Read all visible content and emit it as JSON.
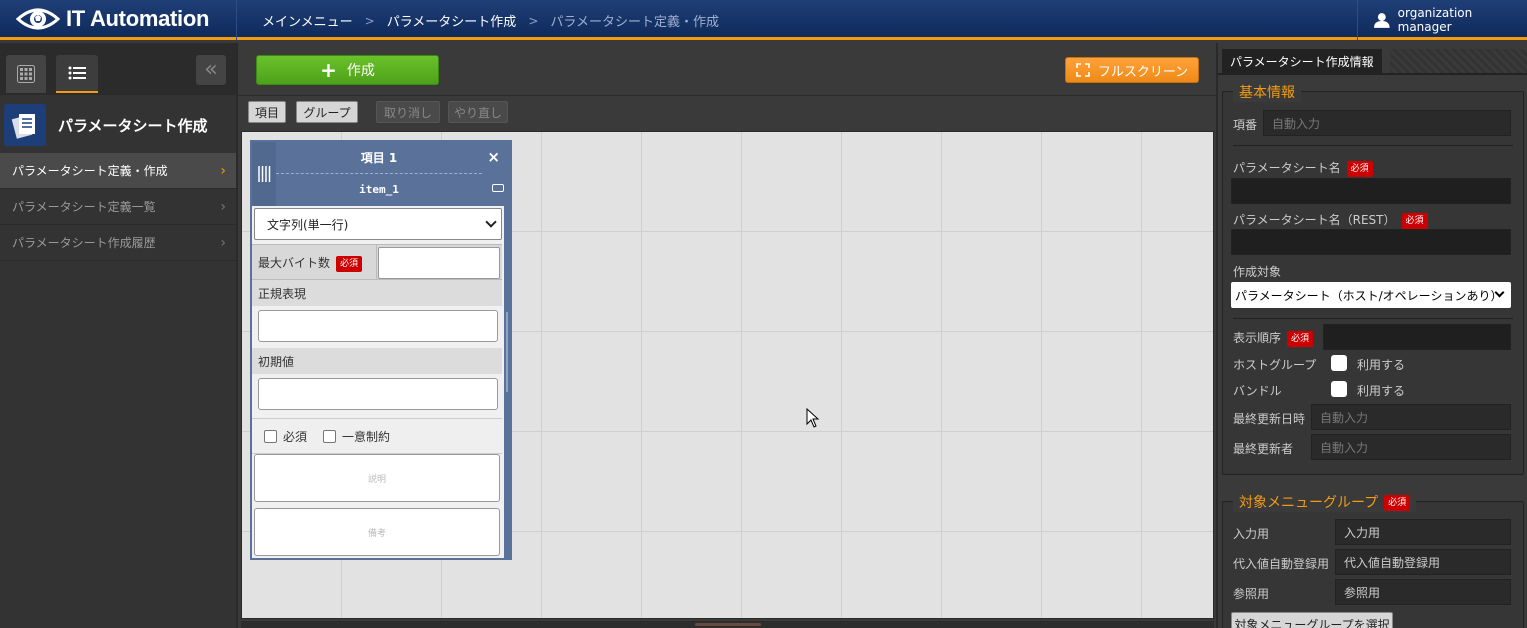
{
  "header": {
    "app_title": "IT Automation",
    "breadcrumb": [
      "メインメニュー",
      "パラメータシート作成",
      "パラメータシート定義・作成"
    ],
    "user": "organization manager",
    "accent_color": "#f39c12",
    "header_color": "#1a3a72"
  },
  "sidebar": {
    "title": "パラメータシート作成",
    "items": [
      {
        "label": "パラメータシート定義・作成",
        "active": true
      },
      {
        "label": "パラメータシート定義一覧",
        "active": false
      },
      {
        "label": "パラメータシート作成履歴",
        "active": false
      }
    ]
  },
  "main": {
    "create_label": "作成",
    "fullscreen_label": "フルスクリーン",
    "toolbar": {
      "item": "項目",
      "group": "グループ",
      "undo": "取り消し",
      "redo": "やり直し"
    },
    "card": {
      "title": "項目 1",
      "name": "item_1",
      "type": "文字列(単一行)",
      "max_bytes_label": "最大バイト数",
      "required_badge": "必須",
      "regex_label": "正規表現",
      "default_label": "初期値",
      "required_check": "必須",
      "unique_check": "一意制約",
      "description_placeholder": "説明",
      "remarks_placeholder": "備考"
    }
  },
  "right_panel": {
    "tab": "パラメータシート作成情報",
    "basic": {
      "legend": "基本情報",
      "item_no_label": "項番",
      "auto_input": "自動入力",
      "sheet_name_label": "パラメータシート名",
      "sheet_name_rest_label": "パラメータシート名（REST）",
      "required_badge": "必須",
      "target_label": "作成対象",
      "target_value": "パラメータシート（ホスト/オペレーションあり）",
      "order_label": "表示順序",
      "hostgroup_label": "ホストグループ",
      "bundle_label": "バンドル",
      "use_label": "利用する",
      "updated_at_label": "最終更新日時",
      "updated_by_label": "最終更新者"
    },
    "menu_group": {
      "legend": "対象メニューグループ",
      "input_label": "入力用",
      "input_value": "入力用",
      "subst_label": "代入値自動登録用",
      "subst_value": "代入値自動登録用",
      "ref_label": "参照用",
      "ref_value": "参照用",
      "select_button": "対象メニューグループを選択"
    }
  }
}
